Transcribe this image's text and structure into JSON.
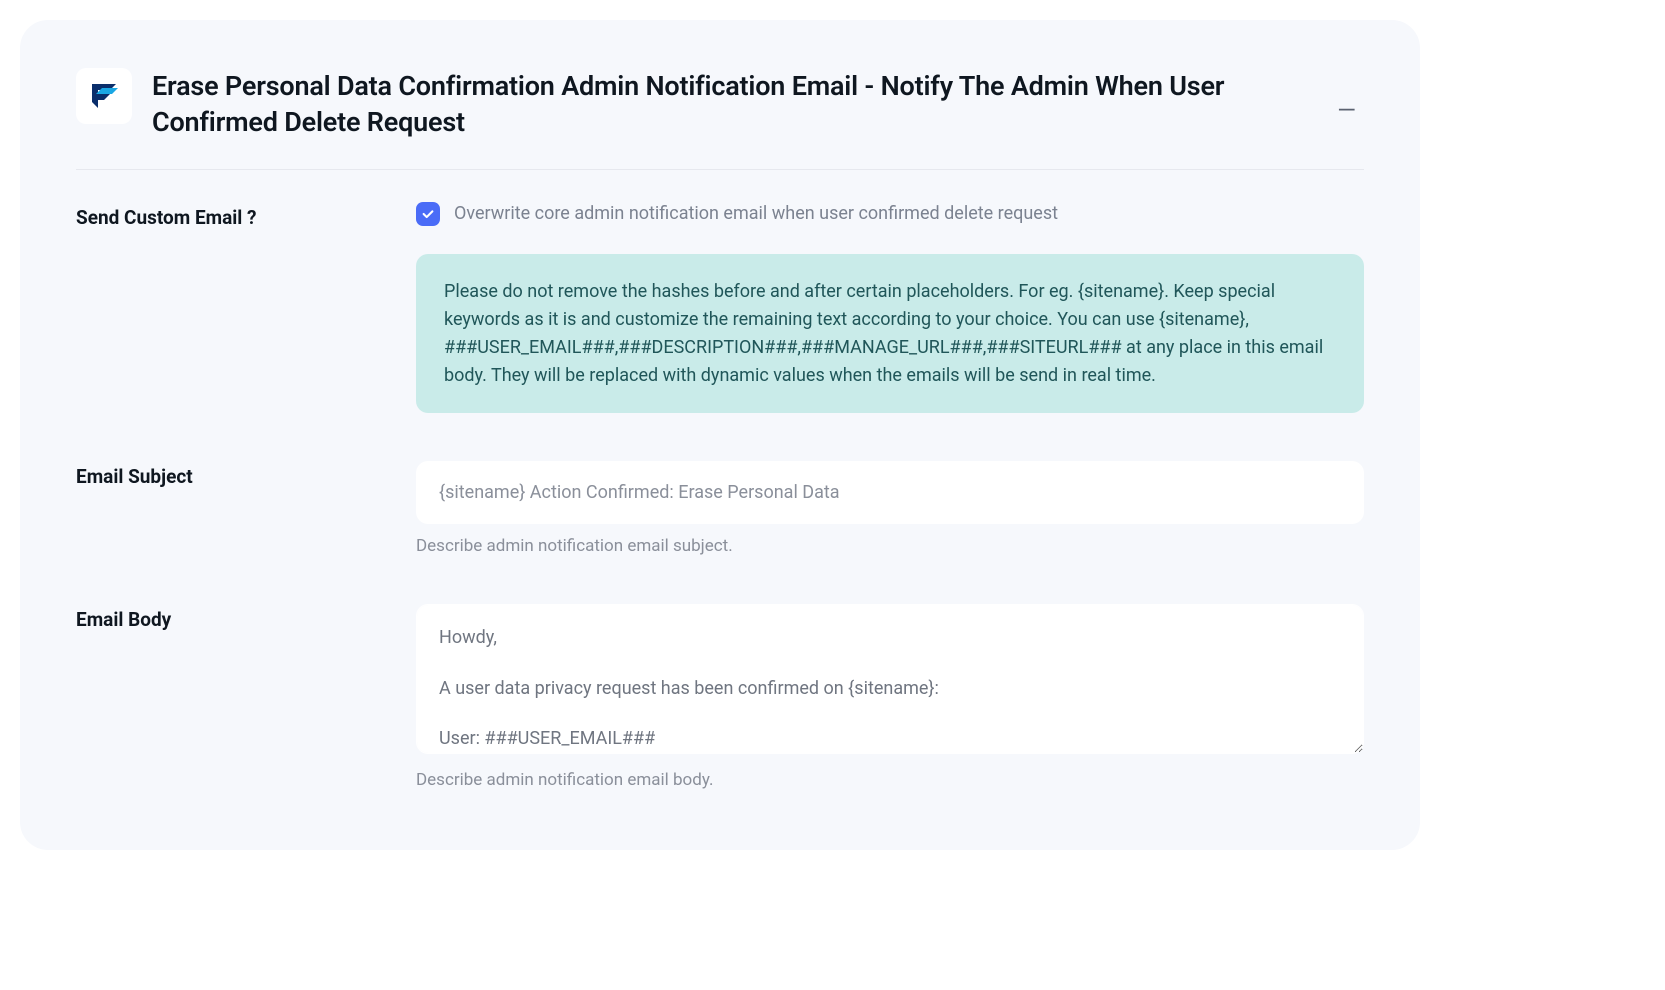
{
  "header": {
    "title": "Erase Personal Data Confirmation Admin Notification Email - Notify The Admin When User Confirmed Delete Request",
    "collapse_glyph": "—"
  },
  "sendCustom": {
    "label": "Send Custom Email ?",
    "checked": true,
    "description": "Overwrite core admin notification email when user confirmed delete request",
    "info_text": "Please do not remove the hashes before and after certain placeholders. For eg. {sitename}. Keep special keywords as it is and customize the remaining text according to your choice. You can use {sitename}, ###USER_EMAIL###,###DESCRIPTION###,###MANAGE_URL###,###SITEURL### at any place in this email body. They will be replaced with dynamic values when the emails will be send in real time."
  },
  "emailSubject": {
    "label": "Email Subject",
    "value": "{sitename} Action Confirmed: Erase Personal Data",
    "help": "Describe admin notification email subject."
  },
  "emailBody": {
    "label": "Email Body",
    "value": "Howdy,\n\nA user data privacy request has been confirmed on {sitename}:\n\nUser: ###USER_EMAIL###\nRequest: ###DESCRIPTION###",
    "help": "Describe admin notification email body."
  }
}
